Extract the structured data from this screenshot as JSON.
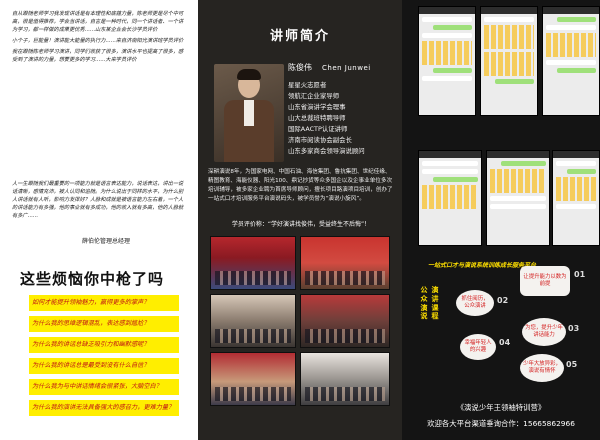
{
  "left": {
    "quotes": [
      "自从跟随老师学习我发现讲话是有本理性和底蕴力量，陈老师更是尽个中可高，很是值得推荐，学会当讲话，自言是一种时代，同一个讲话者、一个讲为学习，都一样做的成果更优秀……山东某企业会长沙学员评价",
      "小个子，巨能量！演讲能大能量的执行力……来自济南阳光演讲班学员评价",
      "我在跟随陈老师学习演讲，同学们收获了很多，演讲水平也提高了很多，感受到了演讲的力量，想要更多的学习……大来学员评价"
    ],
    "long_quote": "人一生跟随我们最重要的一项能力就是语言表达能力，说话表达，讲出一说话清晰，感情充沛，被人认同和追随。为什么说出于同样的水平，为什么别人讲话就有人听，影响力发挥好？人脉和成就是被语言能力左右着，一个人的讲话能力有多强，他的事业就有多成功，他的收入就有多高，他的人脉就有多广……",
    "signature": "薛伯伦管理总经理",
    "headline": "这些烦恼你中枪了吗",
    "pain_points": [
      "如何才能提升领袖魅力，赢得更多的掌声？",
      "为什么我的思维逻辑混乱，表达感到尴尬？",
      "为什么我的讲话总缺乏吸引力和幽默感呢？",
      "为什么我的讲话总是最受到没有什么自信？",
      "为什么我为与中讲话情绪会很紧张，大脑空白？",
      "为什么我的演讲无法具备强大的感召力，更难力量？"
    ]
  },
  "middle": {
    "title": "讲师简介",
    "name": "陈俊伟",
    "name_en": "Chen Junwei",
    "titles": [
      "星星火志愿者",
      "领航汇企业家导师",
      "山东省演讲学会理事",
      "山大总裁班特聘导师",
      "国际AACTP认证讲师",
      "济南市阅读协会副会长",
      "山东多家商会领导演说顾问"
    ],
    "bio": "深耕演说8年，为国家电网、中国石油、海信集团、鲁抗集团、世纪佳缘、精图教育、海能仪器、阳光100、鼎记抄货等众多国企以及企事业单位多次培训辅导，被多家企业聘为首席导师顾问，擅长项目路演项目培训，创办了一站式口才培训服务平台演说码头，被学员誉为“演说小旋风”。",
    "evaluation": "学员评价称：“学好演讲找俊伟，受益终生不后悔”！",
    "photos": [
      "training-photo-1",
      "training-photo-2",
      "training-photo-3",
      "training-photo-4",
      "training-photo-5",
      "training-photo-6"
    ]
  },
  "right": {
    "chat_screenshots": 6,
    "title": "一站式口才与演说系统训练成长服务平台",
    "vertical_1": "公众演说",
    "vertical_2": "演讲课程",
    "steps": [
      {
        "num": "01",
        "text": "让提升能力以数为前提"
      },
      {
        "num": "02",
        "text": "抓住阅历，公众演讲"
      },
      {
        "num": "03",
        "text": "为您，提升少年讲话能力"
      },
      {
        "num": "04",
        "text": "幸福年轻人的兴趣"
      },
      {
        "num": "05",
        "text": "少年大放异彩，演说有情怀"
      }
    ],
    "program": "《演说少年王领袖特训营》",
    "contact": "欢迎各大平台渠道垂询合作：15665862966"
  }
}
